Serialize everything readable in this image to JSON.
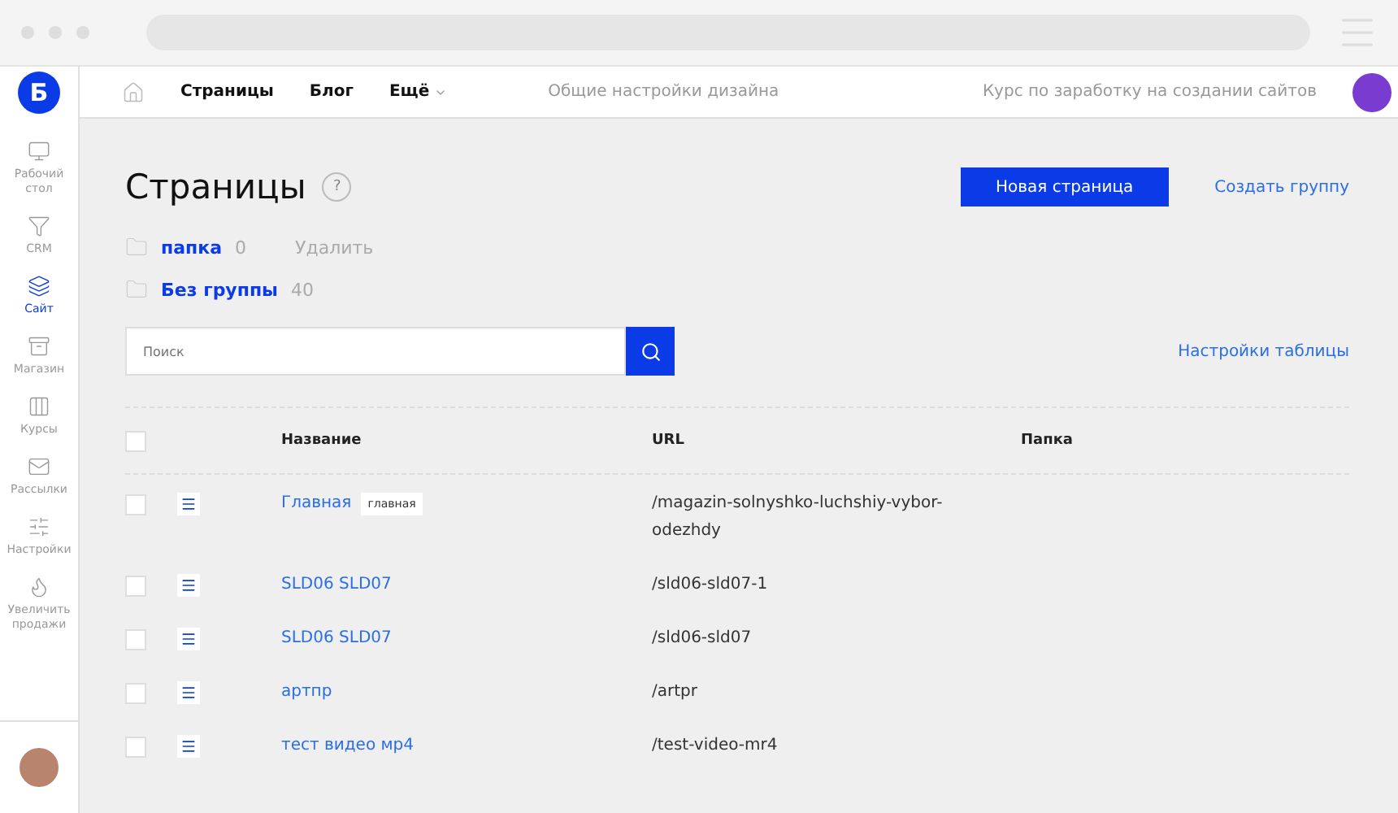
{
  "logo": "Б",
  "nav": {
    "items": [
      {
        "label": "Страницы",
        "dropdown": false
      },
      {
        "label": "Блог",
        "dropdown": false
      },
      {
        "label": "Ещё",
        "dropdown": true
      }
    ],
    "center": "Общие настройки дизайна",
    "course": "Курс по заработку на создании сайтов"
  },
  "sidebar": {
    "items": [
      {
        "kind": "desktop",
        "label": "Рабочий стол",
        "selected": false
      },
      {
        "kind": "crm",
        "label": "CRM",
        "selected": false
      },
      {
        "kind": "site",
        "label": "Сайт",
        "selected": true
      },
      {
        "kind": "shop",
        "label": "Магазин",
        "selected": false
      },
      {
        "kind": "courses",
        "label": "Курсы",
        "selected": false
      },
      {
        "kind": "mail",
        "label": "Рассылки",
        "selected": false
      },
      {
        "kind": "settings",
        "label": "Настройки",
        "selected": false
      },
      {
        "kind": "fire",
        "label": "Увеличить продажи",
        "selected": false
      }
    ]
  },
  "page": {
    "title": "Страницы",
    "help": "?",
    "new_button": "Новая страница",
    "create_group": "Создать группу"
  },
  "groups": [
    {
      "name": "папка",
      "count": "0",
      "action": "Удалить"
    },
    {
      "name": "Без группы",
      "count": "40"
    }
  ],
  "search": {
    "placeholder": "Поиск"
  },
  "table_settings": "Настройки таблицы",
  "table": {
    "columns": [
      "Название",
      "URL",
      "Папка"
    ],
    "all_checked": false,
    "rows": [
      {
        "checked": false,
        "name": "Главная",
        "tag": "главная",
        "url": "/magazin-solnyshko-luchshiy-vybor-odezhdy"
      },
      {
        "checked": false,
        "name": "SLD06 SLD07",
        "url": "/sld06-sld07-1"
      },
      {
        "checked": false,
        "name": "SLD06 SLD07",
        "url": "/sld06-sld07"
      },
      {
        "checked": false,
        "name": "артпр",
        "url": "/artpr"
      },
      {
        "checked": false,
        "name": "тест видео мр4",
        "url": "/test-video-mr4"
      }
    ]
  }
}
